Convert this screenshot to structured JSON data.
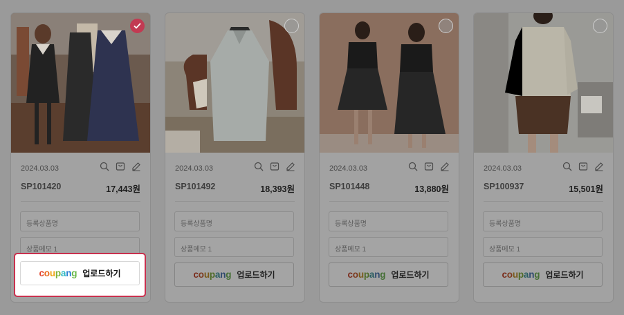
{
  "upload_label": "업로드하기",
  "brand_letters": [
    "c",
    "o",
    "u",
    "p",
    "a",
    "n",
    "g"
  ],
  "colors": {
    "highlight_border": "#c9304e",
    "selected_check": "#c23a52",
    "overlay": "#9a9a9a"
  },
  "products": [
    {
      "date": "2024.03.03",
      "code": "SP101420",
      "price": "17,443원",
      "name_placeholder": "등록상품명",
      "memo_placeholder": "상품메모 1",
      "selected": true
    },
    {
      "date": "2024.03.03",
      "code": "SP101492",
      "price": "18,393원",
      "name_placeholder": "등록상품명",
      "memo_placeholder": "상품메모 1",
      "selected": false
    },
    {
      "date": "2024.03.03",
      "code": "SP101448",
      "price": "13,880원",
      "name_placeholder": "등록상품명",
      "memo_placeholder": "상품메모 1",
      "selected": false
    },
    {
      "date": "2024.03.03",
      "code": "SP100937",
      "price": "15,501원",
      "name_placeholder": "등록상품명",
      "memo_placeholder": "상품메모 1",
      "selected": false
    }
  ],
  "icons": [
    "search-icon",
    "cart-icon",
    "edit-icon",
    "check-icon"
  ]
}
